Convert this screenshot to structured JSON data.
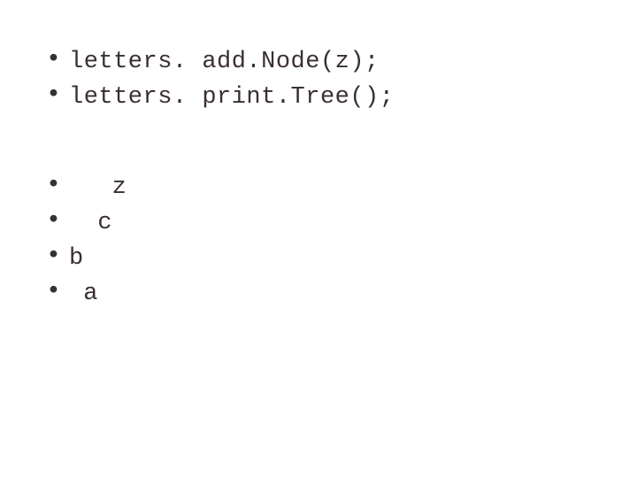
{
  "code": {
    "line1": "letters. add.Node(z);",
    "line2": "letters. print.Tree();"
  },
  "output": {
    "line1": "   z",
    "line2": "  c",
    "line3": "b",
    "line4": " a"
  }
}
